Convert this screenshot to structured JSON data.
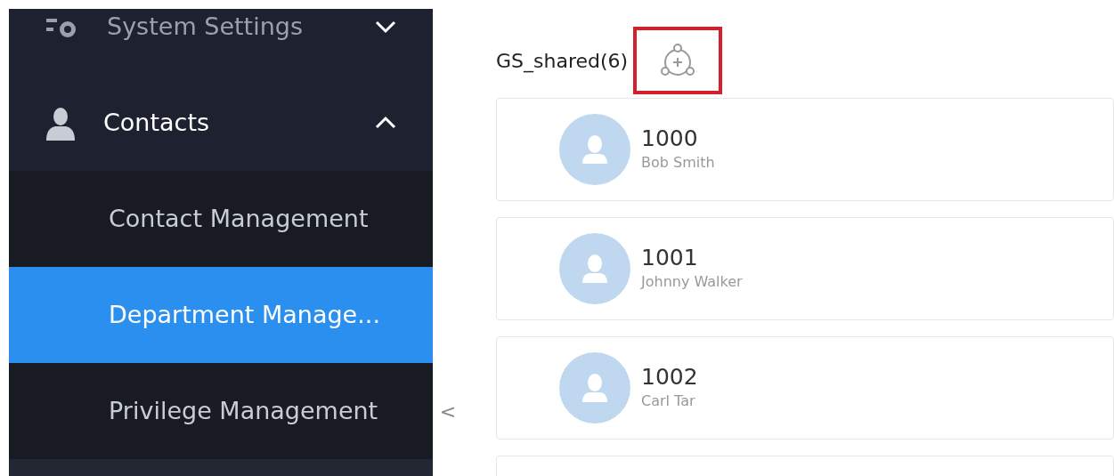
{
  "sidebar": {
    "items": [
      {
        "label": "System Settings",
        "kind": "section",
        "expanded": false
      },
      {
        "label": "Contacts",
        "kind": "section",
        "expanded": true,
        "children": [
          {
            "label": "Contact Management",
            "selected": false
          },
          {
            "label": "Department Manage...",
            "selected": true
          },
          {
            "label": "Privilege Management",
            "selected": false
          }
        ]
      }
    ]
  },
  "collapse_handle": {
    "label": "<"
  },
  "group": {
    "title": "GS_shared(6)",
    "contacts": [
      {
        "number": "1000",
        "name": "Bob Smith"
      },
      {
        "number": "1001",
        "name": "Johnny Walker"
      },
      {
        "number": "1002",
        "name": "Carl Tar"
      },
      {
        "kind": "partial"
      }
    ]
  }
}
